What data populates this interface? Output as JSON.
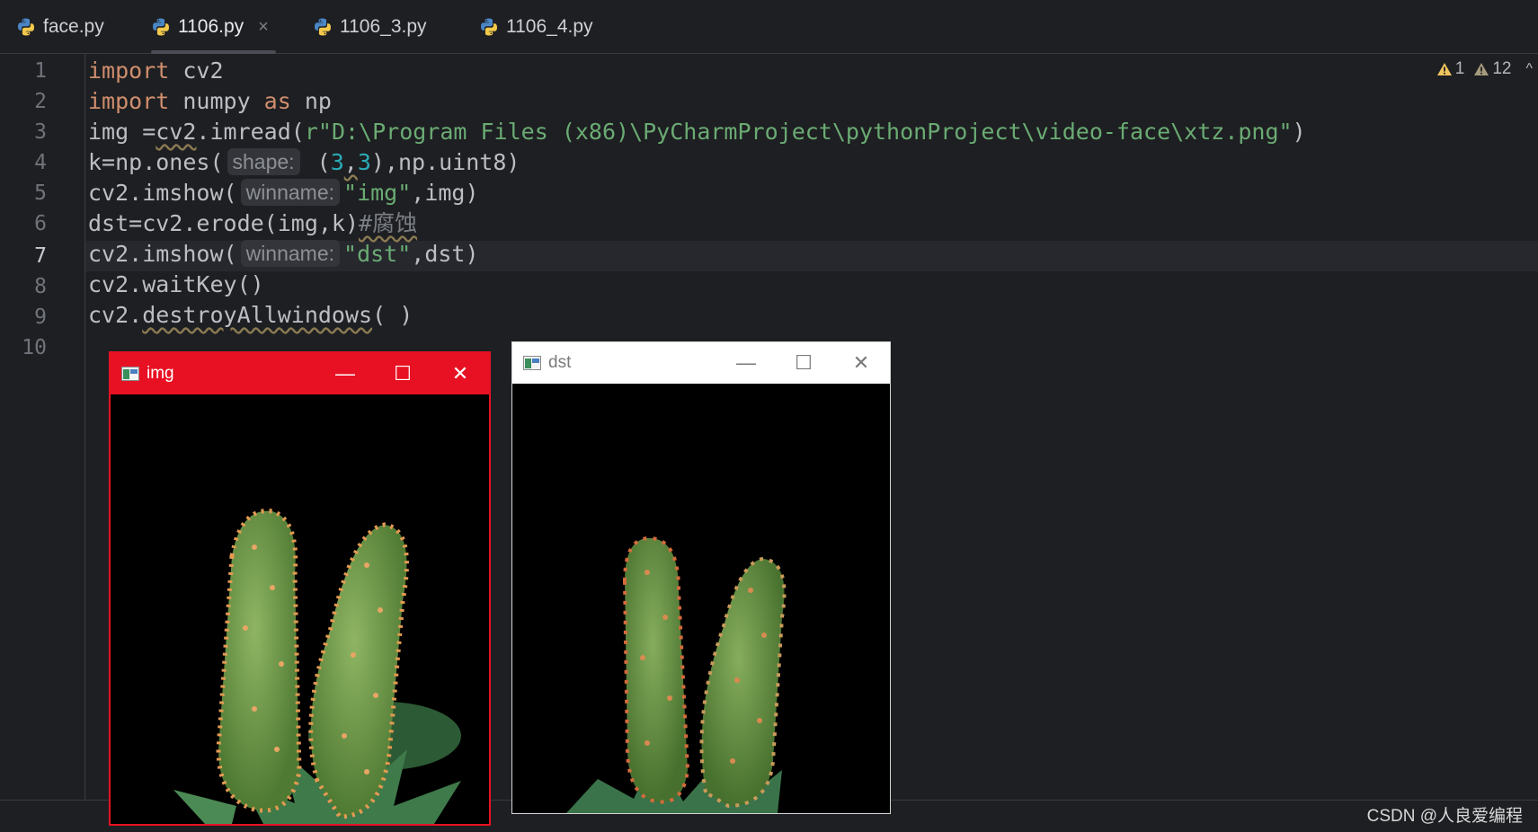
{
  "tabs": [
    {
      "label": "face.py"
    },
    {
      "label": "1106.py",
      "active": true,
      "close": "×"
    },
    {
      "label": "1106_3.py"
    },
    {
      "label": "1106_4.py"
    }
  ],
  "line_numbers": [
    "1",
    "2",
    "3",
    "4",
    "5",
    "6",
    "7",
    "8",
    "9",
    "10"
  ],
  "current_line": "7",
  "code": {
    "l1": {
      "kw": "import",
      "rest": " cv2"
    },
    "l2": {
      "kw1": "import",
      "mid": " numpy ",
      "kw2": "as",
      "rest": " np"
    },
    "l3": {
      "pre": "img =",
      "fn": "cv2",
      "mid": ".imread(",
      "str": "r\"D:\\Program Files (x86)\\PyCharmProject\\pythonProject\\video-face\\xtz.png\"",
      "post": ")"
    },
    "l4": {
      "pre": "k=np.ones(",
      "hint": "shape:",
      "open": " (",
      "n1": "3",
      "comma": ",",
      "n2": "3",
      "post": "),np.uint8)"
    },
    "l5": {
      "pre": "cv2.imshow(",
      "hint": "winname:",
      "str": "\"img\"",
      "post": ",img)"
    },
    "l6": {
      "pre": "dst=cv2.erode(img,k)",
      "comment": "#腐蚀"
    },
    "l7": {
      "pre": "cv2.imshow(",
      "hint": "winname:",
      "str": "\"dst\"",
      "post": ",dst)"
    },
    "l8": {
      "text": "cv2.waitKey()"
    },
    "l9": {
      "pre": "cv2.",
      "fn": "destroyAllwindows",
      "post": "( )"
    }
  },
  "inspections": {
    "warnings_a": "1",
    "warnings_b": "12",
    "chevron": "^"
  },
  "windows": {
    "img": {
      "title": "img",
      "minimize": "—",
      "maximize": "☐",
      "close": "✕"
    },
    "dst": {
      "title": "dst",
      "minimize": "—",
      "maximize": "☐",
      "close": "✕"
    }
  },
  "watermark": "CSDN @人良爱编程",
  "colors": {
    "keyword": "#cf8e6d",
    "string": "#6aab73",
    "number": "#2aacb8",
    "active_window": "#e81123"
  }
}
